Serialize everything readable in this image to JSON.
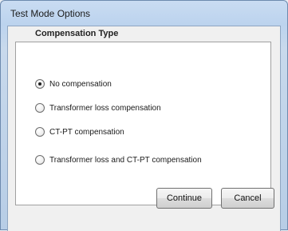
{
  "window": {
    "title": "Test Mode Options"
  },
  "compensation": {
    "heading": "Compensation Type",
    "options": [
      {
        "label": "No compensation",
        "selected": true
      },
      {
        "label": "Transformer loss compensation",
        "selected": false
      },
      {
        "label": "CT-PT compensation",
        "selected": false
      },
      {
        "label": "Transformer loss and CT-PT compensation",
        "selected": false
      }
    ]
  },
  "buttons": {
    "continue_label": "Continue",
    "cancel_label": "Cancel"
  }
}
